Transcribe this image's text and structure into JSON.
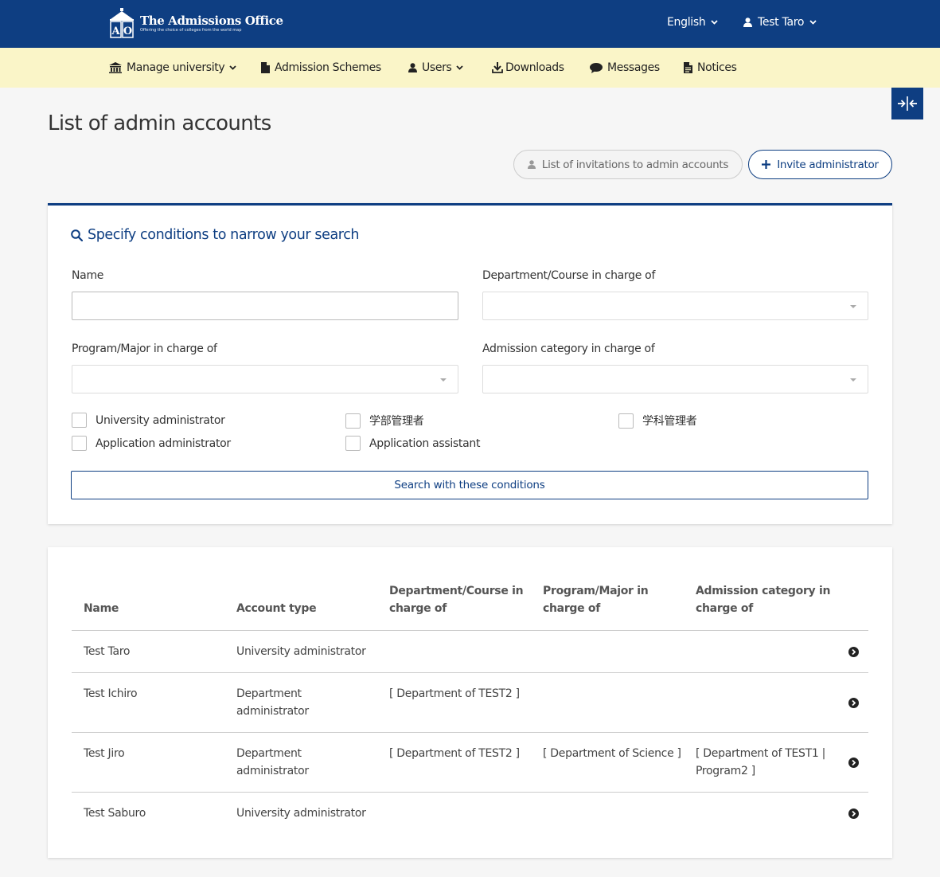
{
  "header": {
    "logo_title": "The Admissions Office",
    "logo_subtitle": "Offering the choice of colleges from the world map",
    "language": "English",
    "user": "Test Taro"
  },
  "nav": {
    "items": [
      {
        "label": "Manage university",
        "icon": "university-icon",
        "has_dropdown": true
      },
      {
        "label": "Admission Schemes",
        "icon": "file-icon",
        "has_dropdown": false
      },
      {
        "label": "Users",
        "icon": "user-icon",
        "has_dropdown": true
      },
      {
        "label": "Downloads",
        "icon": "download-icon",
        "has_dropdown": false
      },
      {
        "label": "Messages",
        "icon": "comment-icon",
        "has_dropdown": false
      },
      {
        "label": "Notices",
        "icon": "file-text-icon",
        "has_dropdown": false
      }
    ]
  },
  "page": {
    "title": "List of admin accounts",
    "invitations_button": "List of invitations to admin accounts",
    "invite_button": "Invite administrator"
  },
  "search": {
    "heading": "Specify conditions to narrow your search",
    "name_label": "Name",
    "name_value": "",
    "department_label": "Department/Course in charge of",
    "program_label": "Program/Major in charge of",
    "category_label": "Admission category in charge of",
    "checkboxes": [
      {
        "label": "University administrator",
        "checked": false
      },
      {
        "label": "学部管理者",
        "checked": false
      },
      {
        "label": "学科管理者",
        "checked": false
      },
      {
        "label": "Application administrator",
        "checked": false
      },
      {
        "label": "Application assistant",
        "checked": false
      }
    ],
    "submit_label": "Search with these conditions"
  },
  "table": {
    "columns": [
      "Name",
      "Account type",
      "Department/Course in charge of",
      "Program/Major in charge of",
      "Admission category in charge of"
    ],
    "rows": [
      {
        "name": "Test Taro",
        "account_type": "University administrator",
        "department": "",
        "program": "",
        "category": ""
      },
      {
        "name": "Test Ichiro",
        "account_type": "Department administrator",
        "department": "[ Department of TEST2 ]",
        "program": "",
        "category": ""
      },
      {
        "name": "Test Jiro",
        "account_type": "Department administrator",
        "department": "[ Department of TEST2 ]",
        "program": "[ Department of Science ]",
        "category": "[ Department of TEST1 | Program2 ]"
      },
      {
        "name": "Test Saburo",
        "account_type": "University administrator",
        "department": "",
        "program": "",
        "category": ""
      }
    ]
  },
  "colors": {
    "primary": "#0e3e82",
    "nav_background": "#faf5c8",
    "page_background": "#f6f6f6"
  }
}
